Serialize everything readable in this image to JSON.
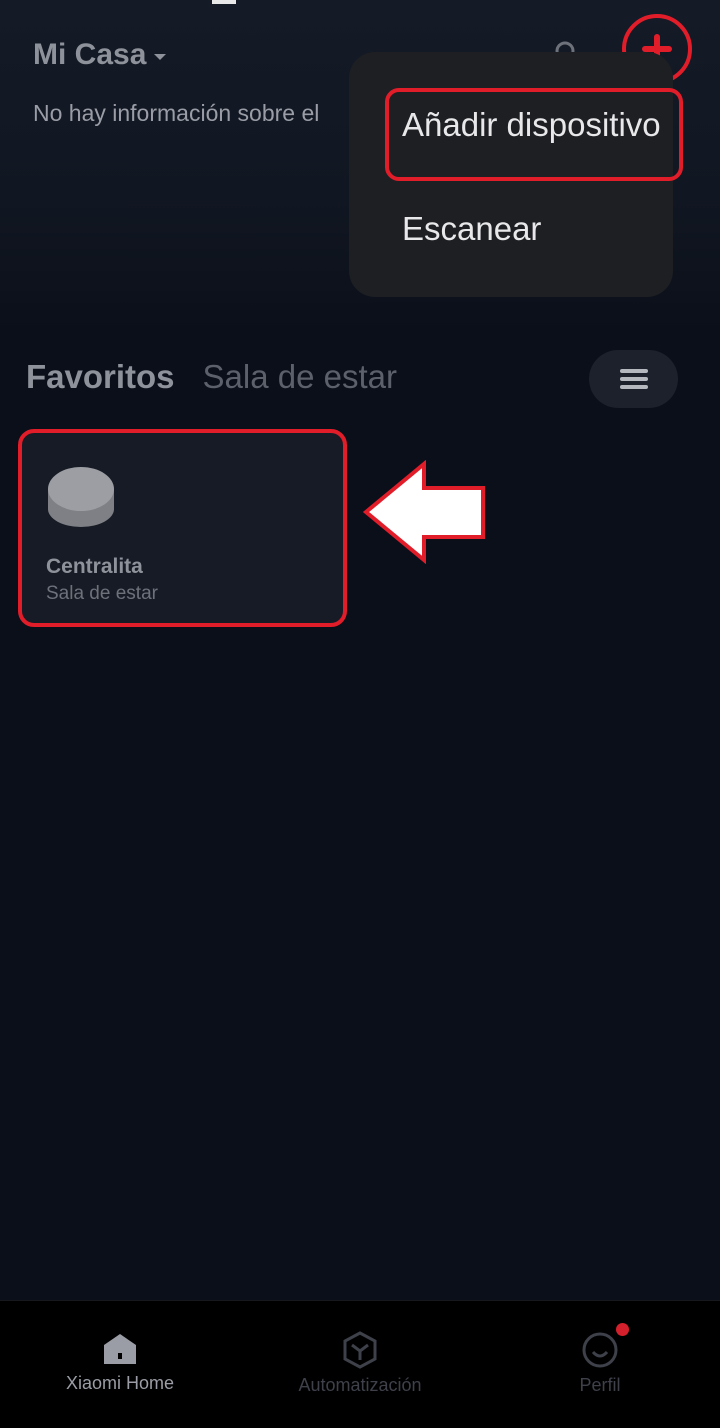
{
  "header": {
    "title": "Mi Casa",
    "subtitle": "No hay información sobre el"
  },
  "menu": {
    "items": [
      {
        "label": "Añadir dispositivo"
      },
      {
        "label": "Escanear"
      }
    ]
  },
  "tabs": [
    {
      "label": "Favoritos",
      "active": true
    },
    {
      "label": "Sala de estar",
      "active": false
    }
  ],
  "device_card": {
    "name": "Centralita",
    "room": "Sala de estar"
  },
  "bottom_nav": [
    {
      "label": "Xiaomi Home",
      "icon": "home-icon",
      "active": true
    },
    {
      "label": "Automatización",
      "icon": "automation-icon",
      "active": false
    },
    {
      "label": "Perfil",
      "icon": "profile-icon",
      "active": false
    }
  ],
  "colors": {
    "accent_red": "#e21d2a",
    "background": "#0b0f19",
    "menu_bg": "#1e1f23"
  }
}
